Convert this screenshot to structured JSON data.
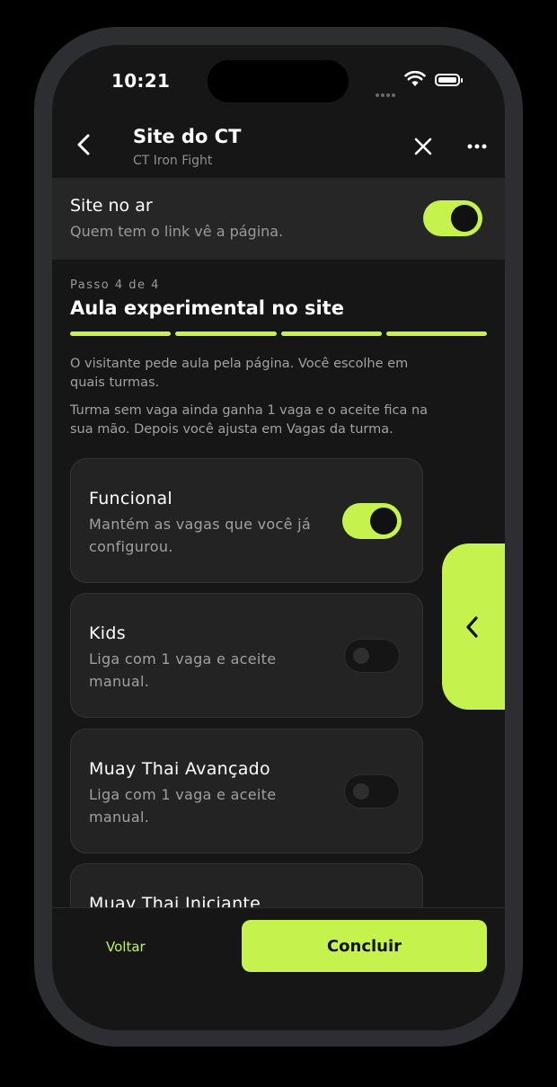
{
  "status": {
    "time": "10:21"
  },
  "header": {
    "title": "Site do CT",
    "subtitle": "CT Iron Fight"
  },
  "site_status": {
    "title": "Site no ar",
    "description": "Quem tem o link vê a página.",
    "enabled": true
  },
  "step": {
    "label": "Passo 4 de 4",
    "title": "Aula experimental no site",
    "progress_filled": 4,
    "progress_total": 4,
    "paragraph1": "O visitante pede aula pela página. Você escolhe em quais turmas.",
    "paragraph2": "Turma sem vaga ainda ganha 1 vaga e o aceite fica na sua mão. Depois você ajusta em Vagas da turma."
  },
  "classes": [
    {
      "name": "Funcional",
      "description": "Mantém as vagas que você já configurou.",
      "enabled": true
    },
    {
      "name": "Kids",
      "description": "Liga com 1 vaga e aceite manual.",
      "enabled": false
    },
    {
      "name": "Muay Thai Avançado",
      "description": "Liga com 1 vaga e aceite manual.",
      "enabled": false
    },
    {
      "name": "Muay Thai Iniciante",
      "description": "",
      "enabled": false
    }
  ],
  "footer": {
    "back_label": "Voltar",
    "done_label": "Concluir"
  },
  "colors": {
    "accent": "#c6f24e",
    "background": "#161616",
    "card": "#232323"
  },
  "icons": [
    "back-icon",
    "close-icon",
    "more-icon",
    "wifi-icon",
    "battery-icon",
    "chevron-left-icon"
  ]
}
